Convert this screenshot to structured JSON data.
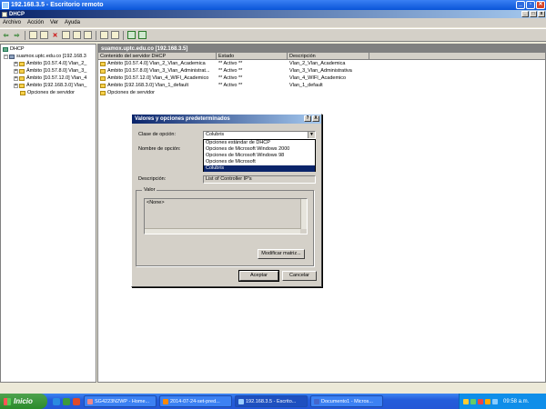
{
  "remote_window": {
    "title": "192.168.3.5 - Escritorio remoto"
  },
  "mmc": {
    "title": "DHCP",
    "menu": [
      "Archivo",
      "Acción",
      "Ver",
      "Ayuda"
    ]
  },
  "tree": {
    "root": "DHCP",
    "server": "suamox.uptc.edu.co [192.168.3",
    "scopes": [
      "Ámbito [10.57.4.0] Vlan_2_",
      "Ámbito [10.57.8.0] Vlan_3_",
      "Ámbito [10.57.12.0] Vlan_4",
      "Ámbito [192.168.3.0] Vlan_"
    ],
    "server_options": "Opciones de servidor"
  },
  "content": {
    "header": "suamox.uptc.edu.co [192.168.3.5]",
    "columns": [
      "Contenido del servidor DHCP",
      "Estado",
      "Descripción"
    ],
    "rows": [
      {
        "name": "Ámbito [10.57.4.0] Vlan_2_Vlan_Academica",
        "status": "** Activo **",
        "desc": "Vlan_2_Vlan_Academica"
      },
      {
        "name": "Ámbito [10.57.8.0] Vlan_3_Vlan_Administrat...",
        "status": "** Activo **",
        "desc": "Vlan_3_Vlan_Administrativa"
      },
      {
        "name": "Ámbito [10.57.12.0] Vlan_4_WIFI_Academico",
        "status": "** Activo **",
        "desc": "Vlan_4_WIFI_Academico"
      },
      {
        "name": "Ámbito [192.168.3.0] Vlan_1_default",
        "status": "** Activo **",
        "desc": "Vlan_1_default"
      },
      {
        "name": "Opciones de servidor",
        "status": "",
        "desc": ""
      }
    ]
  },
  "dialog": {
    "title": "Valores y opciones predeterminados",
    "help": "?",
    "close": "X",
    "class_label": "Clase de opción:",
    "class_value": "Colubris",
    "class_options": [
      "Opciones estándar de DHCP",
      "Opciones de Microsoft Windows 2000",
      "Opciones de Microsoft Windows 98",
      "Opciones de Microsoft",
      "Colubris"
    ],
    "name_label": "Nombre de opción:",
    "desc_label": "Descripción:",
    "desc_value": "List  of Controller IP's",
    "group_label": "Valor",
    "value_text": "<None>",
    "modify_button": "Modificar matriz...",
    "ok_button": "Aceptar",
    "cancel_button": "Cancelar"
  },
  "taskbar": {
    "start": "Inicio",
    "tasks": [
      "SG4223N2WP - Home...",
      "2014-07-24-set-pred...",
      "192.168.3.5 - Escrito...",
      "Documento1 - Micros..."
    ],
    "clock": "09:58 a.m."
  }
}
